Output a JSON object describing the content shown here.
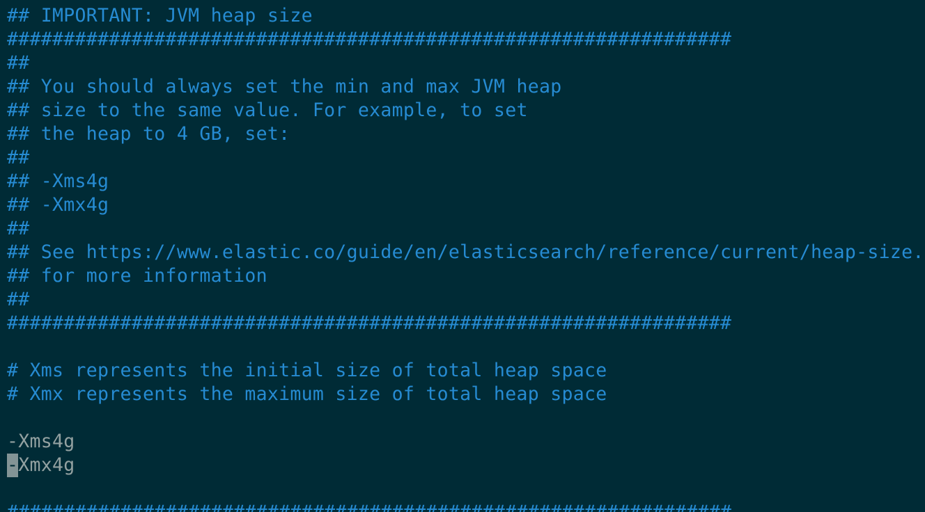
{
  "editor": {
    "lines": [
      "## IMPORTANT: JVM heap size",
      "################################################################",
      "##",
      "## You should always set the min and max JVM heap",
      "## size to the same value. For example, to set",
      "## the heap to 4 GB, set:",
      "##",
      "## -Xms4g",
      "## -Xmx4g",
      "##",
      "## See https://www.elastic.co/guide/en/elasticsearch/reference/current/heap-size.html",
      "## for more information",
      "##",
      "################################################################",
      "",
      "# Xms represents the initial size of total heap space",
      "# Xmx represents the maximum size of total heap space",
      "",
      "-Xms4g",
      "-Xmx4g",
      "",
      "################################################################"
    ],
    "cursor_char": "-",
    "cursor_rest": "Xmx4g"
  },
  "colors": {
    "background": "#002b36",
    "comment": "#268bd2",
    "text": "#93a1a1",
    "cursor": "#839496"
  }
}
